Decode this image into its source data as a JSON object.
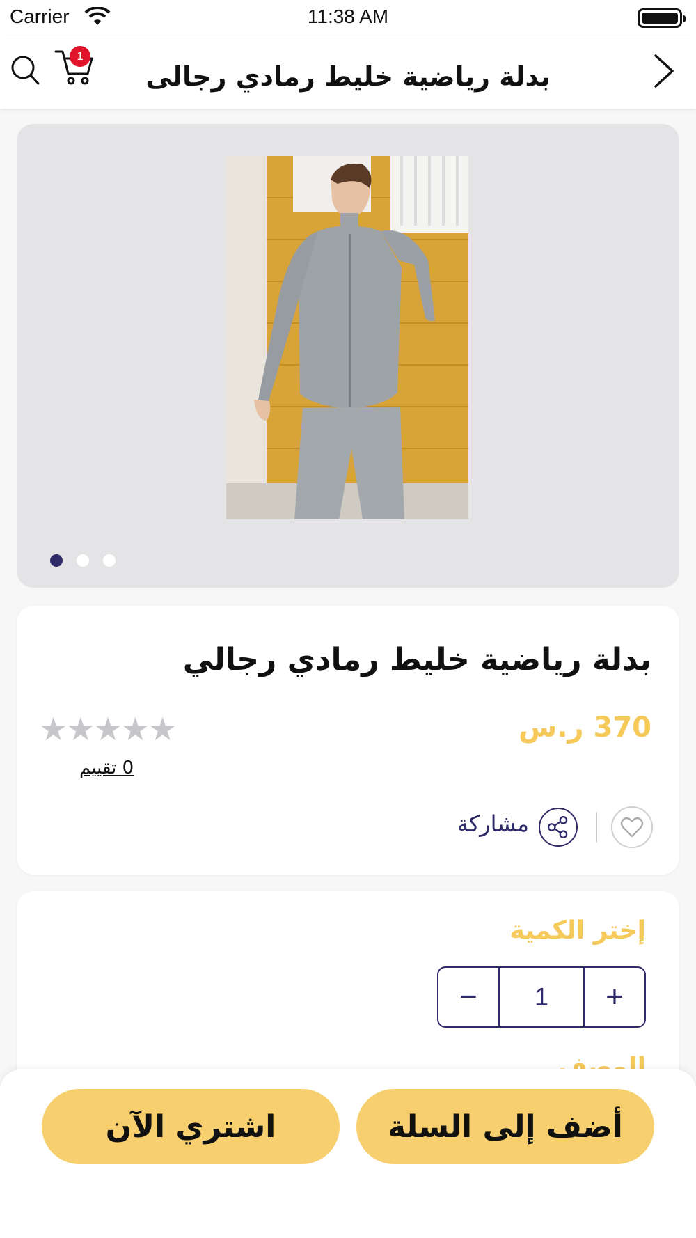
{
  "status_bar": {
    "carrier": "Carrier",
    "time": "11:38 AM"
  },
  "header": {
    "title": "بدلة رياضية خليط رمادي رجالى",
    "cart_count": "1"
  },
  "gallery": {
    "image_count": 3,
    "active_index": 0
  },
  "product": {
    "name": "بدلة رياضية خليط رمادي رجالي",
    "price": "370 ر.س",
    "stars": "★★★★★",
    "rating_value": 0,
    "rating_text": "0  تقييم",
    "share_label": "مشاركة"
  },
  "quantity": {
    "label": "إختر الكمية",
    "value": "1",
    "minus": "−",
    "plus": "+",
    "next_section_label": "الوصف"
  },
  "actions": {
    "add_to_cart": "أضف إلى السلة",
    "buy_now": "اشتري الآن"
  },
  "colors": {
    "accent": "#f7cf6e",
    "primary": "#2f2a68",
    "badge": "#e0142b"
  }
}
